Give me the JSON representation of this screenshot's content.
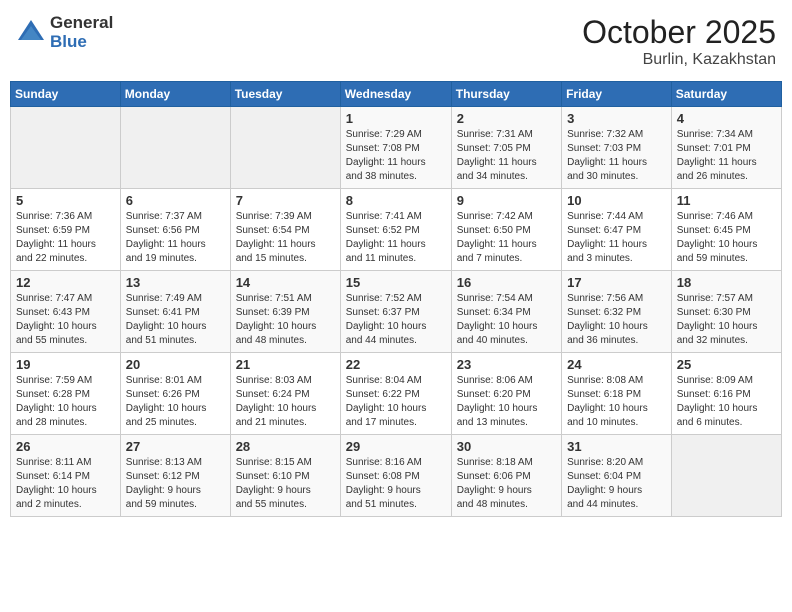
{
  "header": {
    "logo_general": "General",
    "logo_blue": "Blue",
    "month": "October 2025",
    "location": "Burlin, Kazakhstan"
  },
  "days_of_week": [
    "Sunday",
    "Monday",
    "Tuesday",
    "Wednesday",
    "Thursday",
    "Friday",
    "Saturday"
  ],
  "weeks": [
    [
      {
        "day": "",
        "info": ""
      },
      {
        "day": "",
        "info": ""
      },
      {
        "day": "",
        "info": ""
      },
      {
        "day": "1",
        "info": "Sunrise: 7:29 AM\nSunset: 7:08 PM\nDaylight: 11 hours\nand 38 minutes."
      },
      {
        "day": "2",
        "info": "Sunrise: 7:31 AM\nSunset: 7:05 PM\nDaylight: 11 hours\nand 34 minutes."
      },
      {
        "day": "3",
        "info": "Sunrise: 7:32 AM\nSunset: 7:03 PM\nDaylight: 11 hours\nand 30 minutes."
      },
      {
        "day": "4",
        "info": "Sunrise: 7:34 AM\nSunset: 7:01 PM\nDaylight: 11 hours\nand 26 minutes."
      }
    ],
    [
      {
        "day": "5",
        "info": "Sunrise: 7:36 AM\nSunset: 6:59 PM\nDaylight: 11 hours\nand 22 minutes."
      },
      {
        "day": "6",
        "info": "Sunrise: 7:37 AM\nSunset: 6:56 PM\nDaylight: 11 hours\nand 19 minutes."
      },
      {
        "day": "7",
        "info": "Sunrise: 7:39 AM\nSunset: 6:54 PM\nDaylight: 11 hours\nand 15 minutes."
      },
      {
        "day": "8",
        "info": "Sunrise: 7:41 AM\nSunset: 6:52 PM\nDaylight: 11 hours\nand 11 minutes."
      },
      {
        "day": "9",
        "info": "Sunrise: 7:42 AM\nSunset: 6:50 PM\nDaylight: 11 hours\nand 7 minutes."
      },
      {
        "day": "10",
        "info": "Sunrise: 7:44 AM\nSunset: 6:47 PM\nDaylight: 11 hours\nand 3 minutes."
      },
      {
        "day": "11",
        "info": "Sunrise: 7:46 AM\nSunset: 6:45 PM\nDaylight: 10 hours\nand 59 minutes."
      }
    ],
    [
      {
        "day": "12",
        "info": "Sunrise: 7:47 AM\nSunset: 6:43 PM\nDaylight: 10 hours\nand 55 minutes."
      },
      {
        "day": "13",
        "info": "Sunrise: 7:49 AM\nSunset: 6:41 PM\nDaylight: 10 hours\nand 51 minutes."
      },
      {
        "day": "14",
        "info": "Sunrise: 7:51 AM\nSunset: 6:39 PM\nDaylight: 10 hours\nand 48 minutes."
      },
      {
        "day": "15",
        "info": "Sunrise: 7:52 AM\nSunset: 6:37 PM\nDaylight: 10 hours\nand 44 minutes."
      },
      {
        "day": "16",
        "info": "Sunrise: 7:54 AM\nSunset: 6:34 PM\nDaylight: 10 hours\nand 40 minutes."
      },
      {
        "day": "17",
        "info": "Sunrise: 7:56 AM\nSunset: 6:32 PM\nDaylight: 10 hours\nand 36 minutes."
      },
      {
        "day": "18",
        "info": "Sunrise: 7:57 AM\nSunset: 6:30 PM\nDaylight: 10 hours\nand 32 minutes."
      }
    ],
    [
      {
        "day": "19",
        "info": "Sunrise: 7:59 AM\nSunset: 6:28 PM\nDaylight: 10 hours\nand 28 minutes."
      },
      {
        "day": "20",
        "info": "Sunrise: 8:01 AM\nSunset: 6:26 PM\nDaylight: 10 hours\nand 25 minutes."
      },
      {
        "day": "21",
        "info": "Sunrise: 8:03 AM\nSunset: 6:24 PM\nDaylight: 10 hours\nand 21 minutes."
      },
      {
        "day": "22",
        "info": "Sunrise: 8:04 AM\nSunset: 6:22 PM\nDaylight: 10 hours\nand 17 minutes."
      },
      {
        "day": "23",
        "info": "Sunrise: 8:06 AM\nSunset: 6:20 PM\nDaylight: 10 hours\nand 13 minutes."
      },
      {
        "day": "24",
        "info": "Sunrise: 8:08 AM\nSunset: 6:18 PM\nDaylight: 10 hours\nand 10 minutes."
      },
      {
        "day": "25",
        "info": "Sunrise: 8:09 AM\nSunset: 6:16 PM\nDaylight: 10 hours\nand 6 minutes."
      }
    ],
    [
      {
        "day": "26",
        "info": "Sunrise: 8:11 AM\nSunset: 6:14 PM\nDaylight: 10 hours\nand 2 minutes."
      },
      {
        "day": "27",
        "info": "Sunrise: 8:13 AM\nSunset: 6:12 PM\nDaylight: 9 hours\nand 59 minutes."
      },
      {
        "day": "28",
        "info": "Sunrise: 8:15 AM\nSunset: 6:10 PM\nDaylight: 9 hours\nand 55 minutes."
      },
      {
        "day": "29",
        "info": "Sunrise: 8:16 AM\nSunset: 6:08 PM\nDaylight: 9 hours\nand 51 minutes."
      },
      {
        "day": "30",
        "info": "Sunrise: 8:18 AM\nSunset: 6:06 PM\nDaylight: 9 hours\nand 48 minutes."
      },
      {
        "day": "31",
        "info": "Sunrise: 8:20 AM\nSunset: 6:04 PM\nDaylight: 9 hours\nand 44 minutes."
      },
      {
        "day": "",
        "info": ""
      }
    ]
  ]
}
